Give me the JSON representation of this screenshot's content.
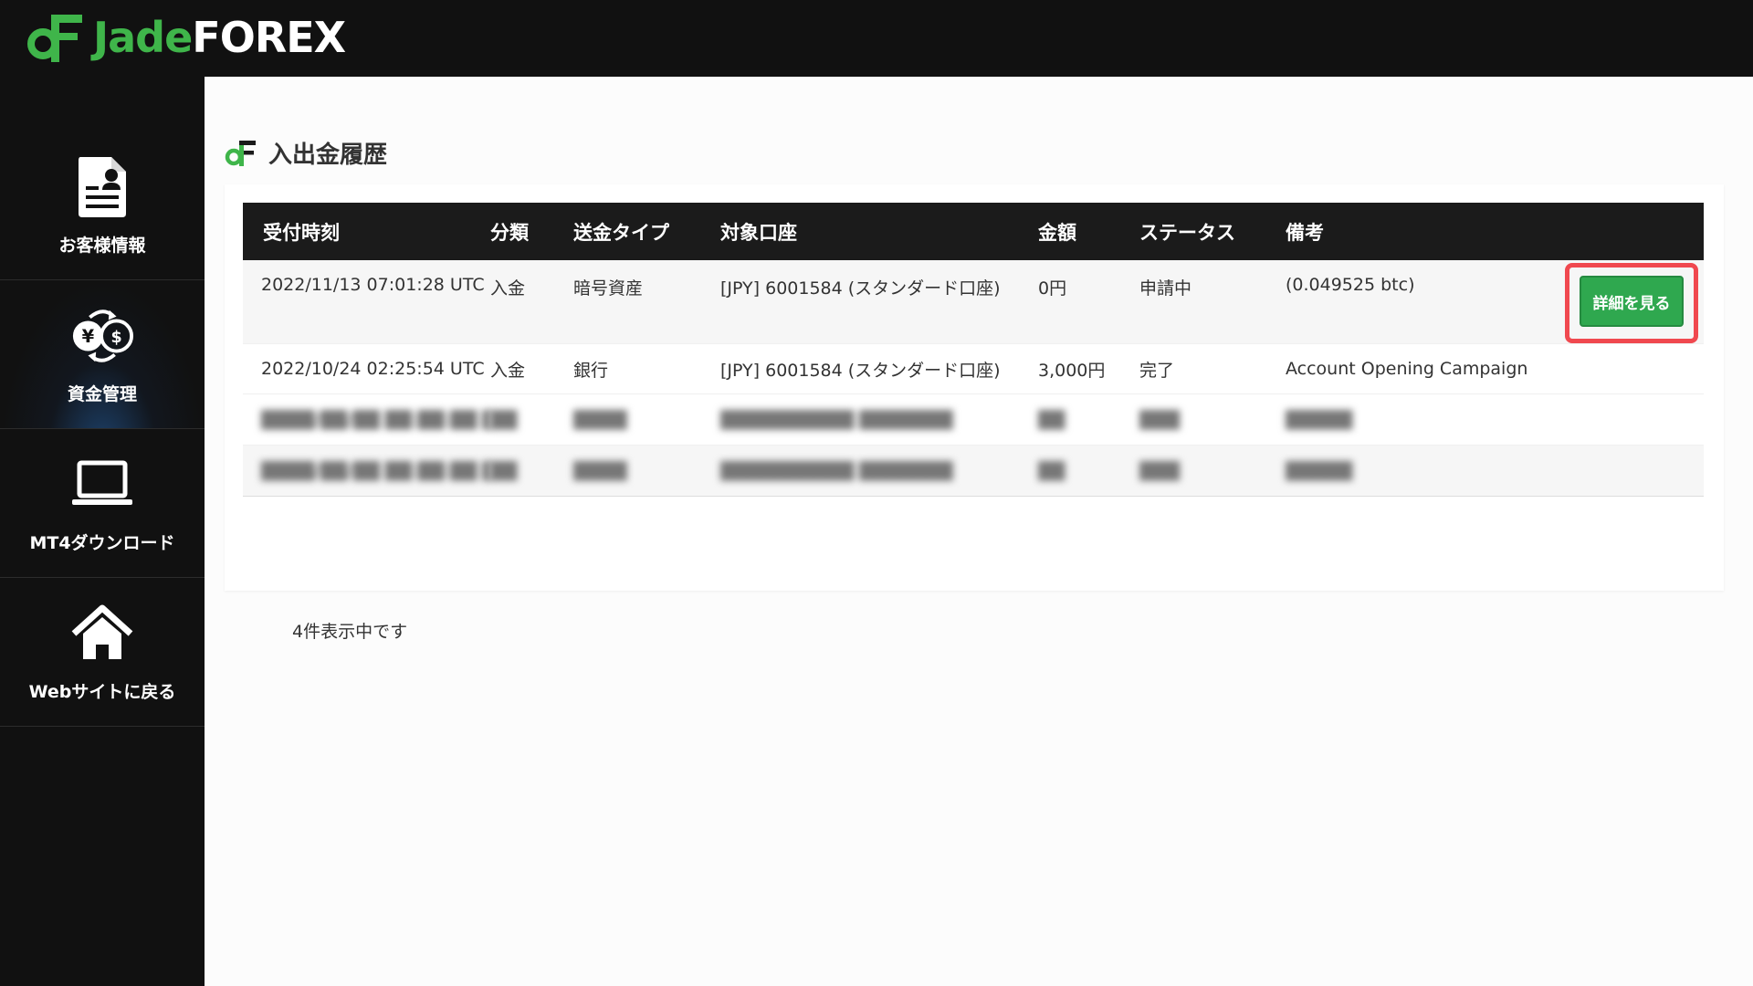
{
  "brand": {
    "name_part1": "Jade",
    "name_part2": "FOREX",
    "color_green": "#3fb54a"
  },
  "sidebar": {
    "items": [
      {
        "label": "お客様情報",
        "icon": "customer-document-icon"
      },
      {
        "label": "資金管理",
        "icon": "currency-exchange-icon",
        "active": true
      },
      {
        "label": "MT4ダウンロード",
        "icon": "laptop-icon"
      },
      {
        "label": "Webサイトに戻る",
        "icon": "home-icon"
      }
    ]
  },
  "page": {
    "title": "入出金履歴"
  },
  "table": {
    "headers": [
      "受付時刻",
      "分類",
      "送金タイプ",
      "対象口座",
      "金額",
      "ステータス",
      "備考"
    ],
    "rows": [
      {
        "time": "2022/11/13 07:01:28 UTC",
        "category": "入金",
        "type": "暗号資産",
        "account": "[JPY] 6001584 (スタンダード口座)",
        "amount": "0円",
        "status": "申請中",
        "note": "(0.049525 btc)",
        "action": "詳細を見る"
      },
      {
        "time": "2022/10/24 02:25:54 UTC",
        "category": "入金",
        "type": "銀行",
        "account": "[JPY] 6001584 (スタンダード口座)",
        "amount": "3,000円",
        "status": "完了",
        "note": "Account Opening Campaign"
      }
    ]
  },
  "footer": {
    "count_text": "4件表示中です"
  },
  "colors": {
    "highlight": "#f0484f",
    "button": "#2fa84f",
    "header_bg": "#1b1b1b"
  }
}
